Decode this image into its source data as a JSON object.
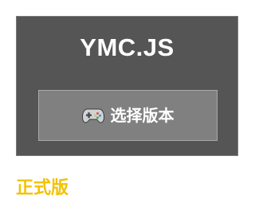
{
  "header": {
    "title": "YMC.JS"
  },
  "version_button": {
    "icon": "gamepad-icon",
    "label": "选择版本"
  },
  "section": {
    "heading": "正式版"
  },
  "colors": {
    "panel_background": "#555555",
    "button_background": "#808080",
    "heading_accent": "#f2c200"
  }
}
